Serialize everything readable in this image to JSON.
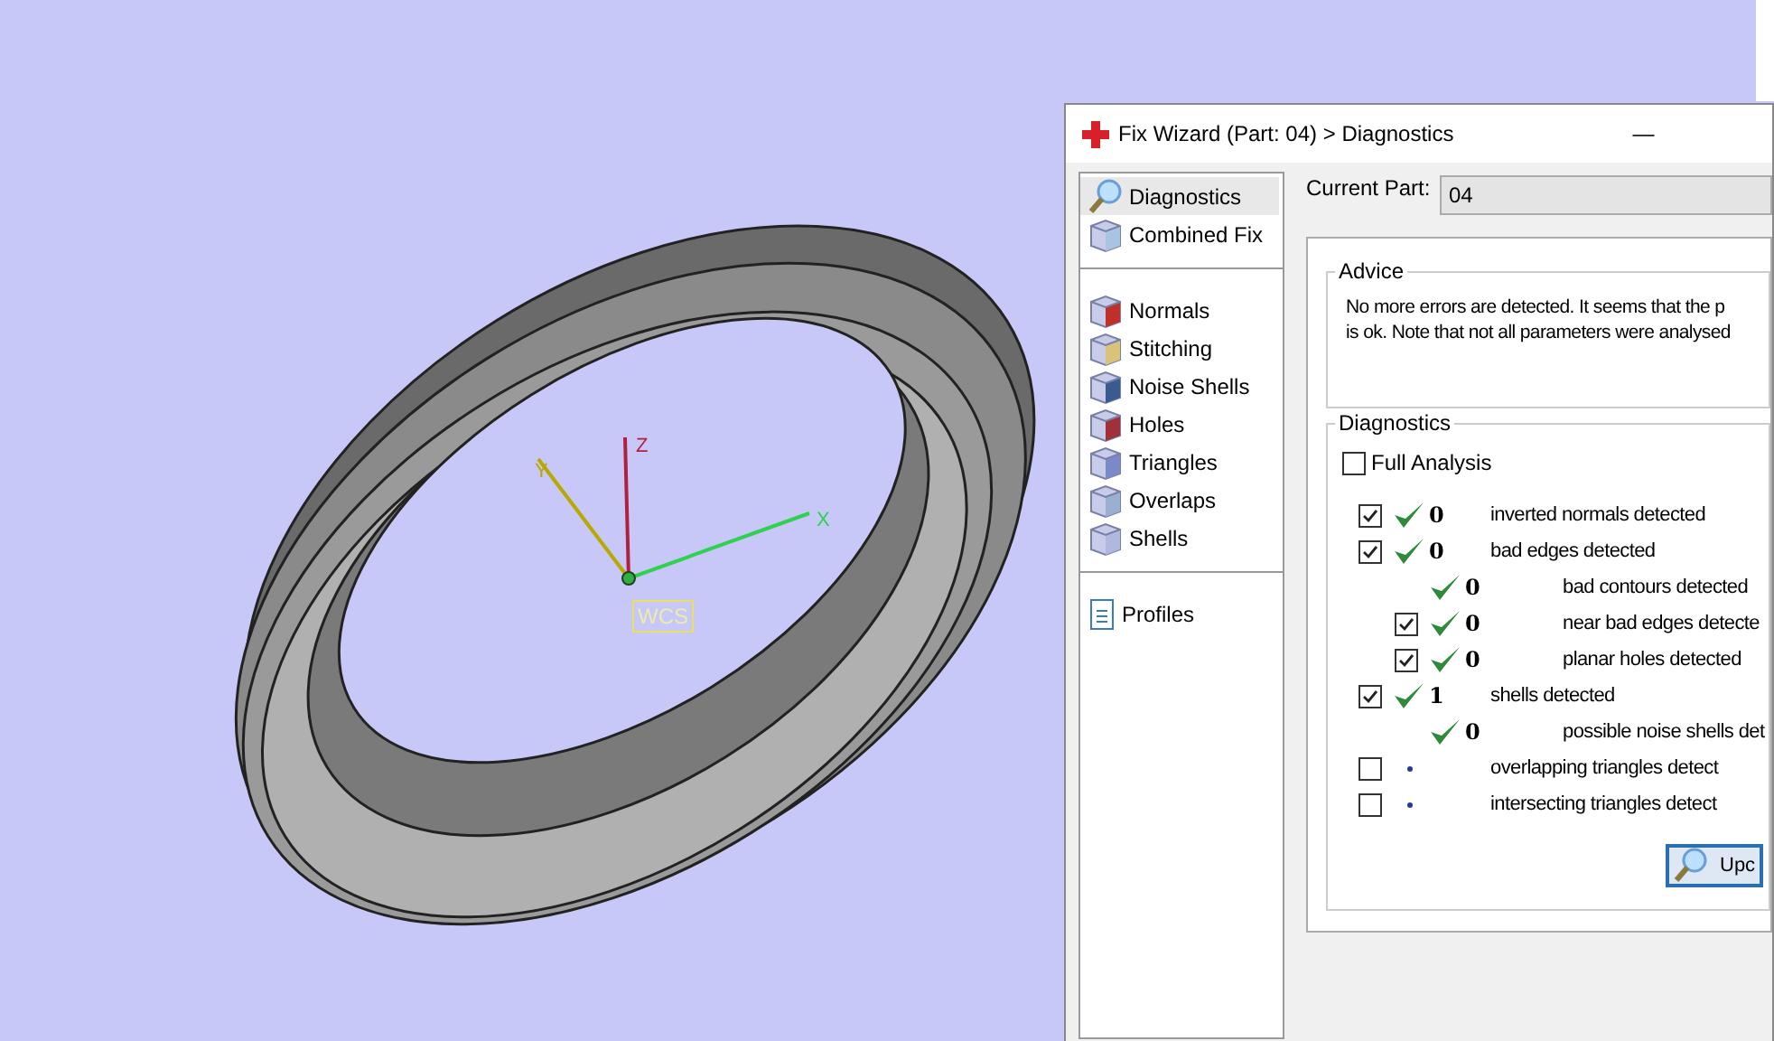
{
  "viewport": {
    "axes": [
      {
        "kind": "z",
        "label": "Z"
      },
      {
        "kind": "x",
        "label": "X"
      },
      {
        "kind": "y",
        "label": "Y"
      }
    ],
    "origin_label": "WCS"
  },
  "dialog": {
    "title": "Fix Wizard (Part: 04) > Diagnostics",
    "minimize": "—",
    "sidebar": {
      "groups": [
        [
          {
            "kind": "diagnostics",
            "label": "Diagnostics",
            "selected": true
          },
          {
            "kind": "combined",
            "label": "Combined Fix",
            "selected": false
          }
        ],
        [
          {
            "kind": "normals",
            "label": "Normals",
            "selected": false
          },
          {
            "kind": "stitching",
            "label": "Stitching",
            "selected": false
          },
          {
            "kind": "noise",
            "label": "Noise Shells",
            "selected": false
          },
          {
            "kind": "holes",
            "label": "Holes",
            "selected": false
          },
          {
            "kind": "triangles",
            "label": "Triangles",
            "selected": false
          },
          {
            "kind": "overlaps",
            "label": "Overlaps",
            "selected": false
          },
          {
            "kind": "shells",
            "label": "Shells",
            "selected": false
          }
        ],
        [
          {
            "kind": "profiles",
            "label": "Profiles",
            "selected": false
          }
        ]
      ]
    },
    "current_part": {
      "label": "Current Part:",
      "value": "04"
    },
    "advice": {
      "title": "Advice",
      "lines": [
        "No more errors are detected. It seems that the p",
        "is ok. Note that not all parameters were analysed"
      ]
    },
    "diagnostics": {
      "title": "Diagnostics",
      "full_analysis": {
        "label": "Full Analysis",
        "checked": false
      },
      "rows": [
        {
          "checked": true,
          "kind": "check",
          "count": "0",
          "label": "inverted normals detected"
        },
        {
          "checked": true,
          "kind": "check",
          "count": "0",
          "label": "bad edges detected",
          "children": [
            {
              "kind": "check",
              "count": "0",
              "label": "bad contours detected"
            },
            {
              "checked": true,
              "kind": "check",
              "count": "0",
              "label": "near bad edges detecte"
            },
            {
              "checked": true,
              "kind": "check",
              "count": "0",
              "label": "planar holes detected"
            }
          ]
        },
        {
          "checked": true,
          "kind": "check",
          "count": "1",
          "label": "shells detected",
          "children": [
            {
              "kind": "check",
              "count": "0",
              "label": "possible noise shells det"
            }
          ]
        },
        {
          "checked": false,
          "kind": "dot",
          "label": "overlapping triangles detect"
        },
        {
          "checked": false,
          "kind": "dot",
          "label": "intersecting triangles detect"
        }
      ],
      "update_button": "Upc"
    }
  }
}
